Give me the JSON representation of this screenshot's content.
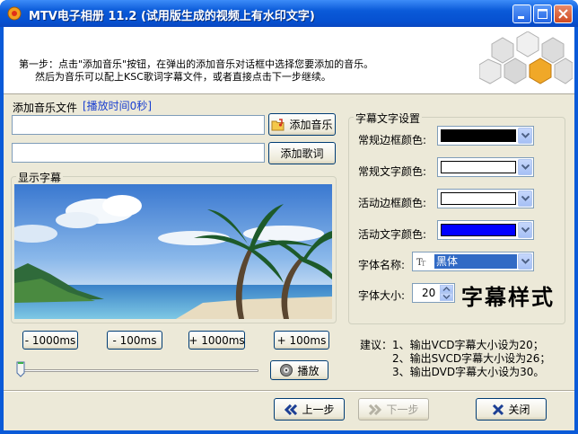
{
  "window": {
    "title": "MTV电子相册 11.2 (试用版生成的视频上有水印文字)"
  },
  "instructions": {
    "line1": "第一步：点击\"添加音乐\"按钮，在弹出的添加音乐对话框中选择您要添加的音乐。",
    "line2": "然后为音乐可以配上KSC歌词字幕文件，或者直接点击下一步继续。"
  },
  "music": {
    "label": "添加音乐文件",
    "duration": "[播放时间0秒]",
    "file_value": "",
    "lyrics_value": "",
    "add_music_label": "添加音乐",
    "add_lyrics_label": "添加歌词"
  },
  "preview": {
    "group_title": "显示字幕"
  },
  "seek": {
    "minus1000": "- 1000ms",
    "minus100": "- 100ms",
    "plus1000": "+ 1000ms",
    "plus100": "+ 100ms",
    "play_label": "播放",
    "position": 0
  },
  "subtitle_settings": {
    "group_title": "字幕文字设置",
    "normal_border_label": "常规边框颜色:",
    "normal_text_label": "常规文字颜色:",
    "active_border_label": "活动边框颜色:",
    "active_text_label": "活动文字颜色:",
    "font_name_label": "字体名称:",
    "font_name_value": "黑体",
    "font_size_label": "字体大小:",
    "font_size_value": "20",
    "sample_text": "字幕样式",
    "colors": {
      "normal_border": "#000000",
      "normal_text": "#ffffff",
      "active_border": "#ffffff",
      "active_text": "#0000ff"
    }
  },
  "advice": {
    "line1": "建议：1、输出VCD字幕大小设为20；",
    "line2": "2、输出SVCD字幕大小设为26；",
    "line3": "3、输出DVD字幕大小设为30。"
  },
  "footer": {
    "prev_label": "上一步",
    "next_label": "下一步",
    "close_label": "关闭"
  }
}
